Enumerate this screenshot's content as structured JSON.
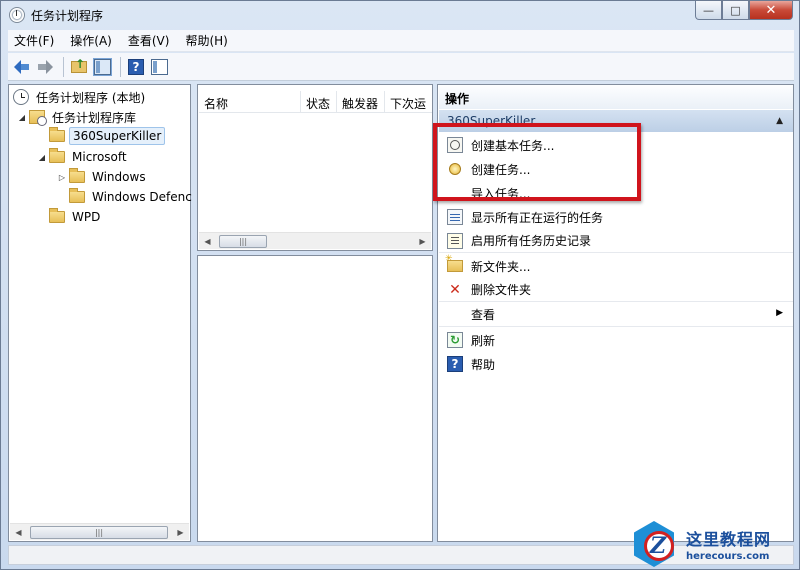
{
  "window": {
    "title": "任务计划程序",
    "controls": {
      "minimize": "—",
      "maximize": "□",
      "close": "✕"
    }
  },
  "menu": [
    "文件(F)",
    "操作(A)",
    "查看(V)",
    "帮助(H)"
  ],
  "toolbar": {
    "icons": [
      "back-arrow-icon",
      "forward-arrow-icon",
      "folder-up-icon",
      "show-hide-pane-icon",
      "help-icon",
      "action-pane-icon"
    ]
  },
  "tree": {
    "root": "任务计划程序 (本地)",
    "library": "任务计划程序库",
    "items": [
      {
        "label": "360SuperKiller",
        "level": 2,
        "selected": true
      },
      {
        "label": "Microsoft",
        "level": 2,
        "expanded": true
      },
      {
        "label": "Windows",
        "level": 3,
        "collapsed": true
      },
      {
        "label": "Windows Defenc",
        "level": 3
      },
      {
        "label": "WPD",
        "level": 2
      }
    ]
  },
  "list": {
    "columns": [
      "名称",
      "状态",
      "触发器",
      "下次运"
    ]
  },
  "actions": {
    "title": "操作",
    "group": "360SuperKiller",
    "items": [
      {
        "label": "创建基本任务...",
        "icon": "create-basic-task-icon"
      },
      {
        "label": "创建任务...",
        "icon": "create-task-icon"
      },
      {
        "label": "导入任务...",
        "icon": ""
      },
      {
        "label": "显示所有正在运行的任务",
        "icon": "running-tasks-icon"
      },
      {
        "label": "启用所有任务历史记录",
        "icon": "task-history-icon"
      },
      {
        "label": "新文件夹...",
        "icon": "new-folder-icon"
      },
      {
        "label": "删除文件夹",
        "icon": "delete-icon"
      },
      {
        "label": "查看",
        "icon": ""
      },
      {
        "label": "刷新",
        "icon": "refresh-icon"
      },
      {
        "label": "帮助",
        "icon": "help-icon"
      }
    ]
  },
  "colors": {
    "highlight": "#d0141c",
    "group_header": "#bccfe6",
    "watermark": "#1b4f9c"
  },
  "watermark": {
    "main": "这里教程网",
    "sub": "herecours.com"
  }
}
